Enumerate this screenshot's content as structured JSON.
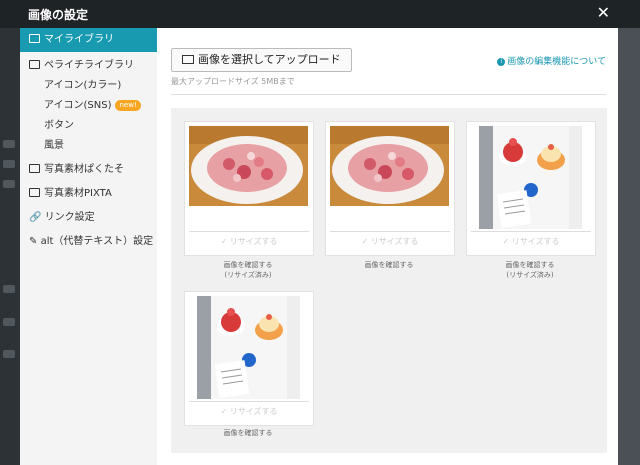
{
  "dialog": {
    "title": "画像の設定",
    "close_icon": "close-icon"
  },
  "sidebar": {
    "items": [
      {
        "label": "マイライブラリ",
        "active": true
      },
      {
        "label": "ペライチライブラリ"
      },
      {
        "label": "アイコン(カラー)",
        "sub": true
      },
      {
        "label": "アイコン(SNS)",
        "sub": true,
        "badge": "new!"
      },
      {
        "label": "ボタン",
        "sub": true
      },
      {
        "label": "風景",
        "sub": true
      },
      {
        "label": "写真素材ぱくたそ"
      },
      {
        "label": "写真素材PIXTA"
      },
      {
        "label": "リンク設定"
      },
      {
        "label": "alt（代替テキスト）設定"
      }
    ]
  },
  "main": {
    "upload_label": "画像を選択してアップロード",
    "max_size": "最大アップロードサイズ 5MBまで",
    "about_link": "画像の編集機能について"
  },
  "images": [
    {
      "kind": "shaved-ice",
      "resize_label": "リサイズする",
      "caption": "画像を確認する",
      "caption2": "(リサイズ済み)"
    },
    {
      "kind": "shaved-ice",
      "resize_label": "リサイズする",
      "caption": "画像を確認する",
      "caption2": ""
    },
    {
      "kind": "cakes",
      "resize_label": "リサイズする",
      "caption": "画像を確認する",
      "caption2": "(リサイズ済み)"
    },
    {
      "kind": "cakes",
      "resize_label": "リサイズする",
      "caption": "画像を確認する",
      "caption2": ""
    }
  ],
  "colors": {
    "accent": "#189ab0",
    "badge": "#f5a623",
    "titlebar": "#1e2326"
  }
}
